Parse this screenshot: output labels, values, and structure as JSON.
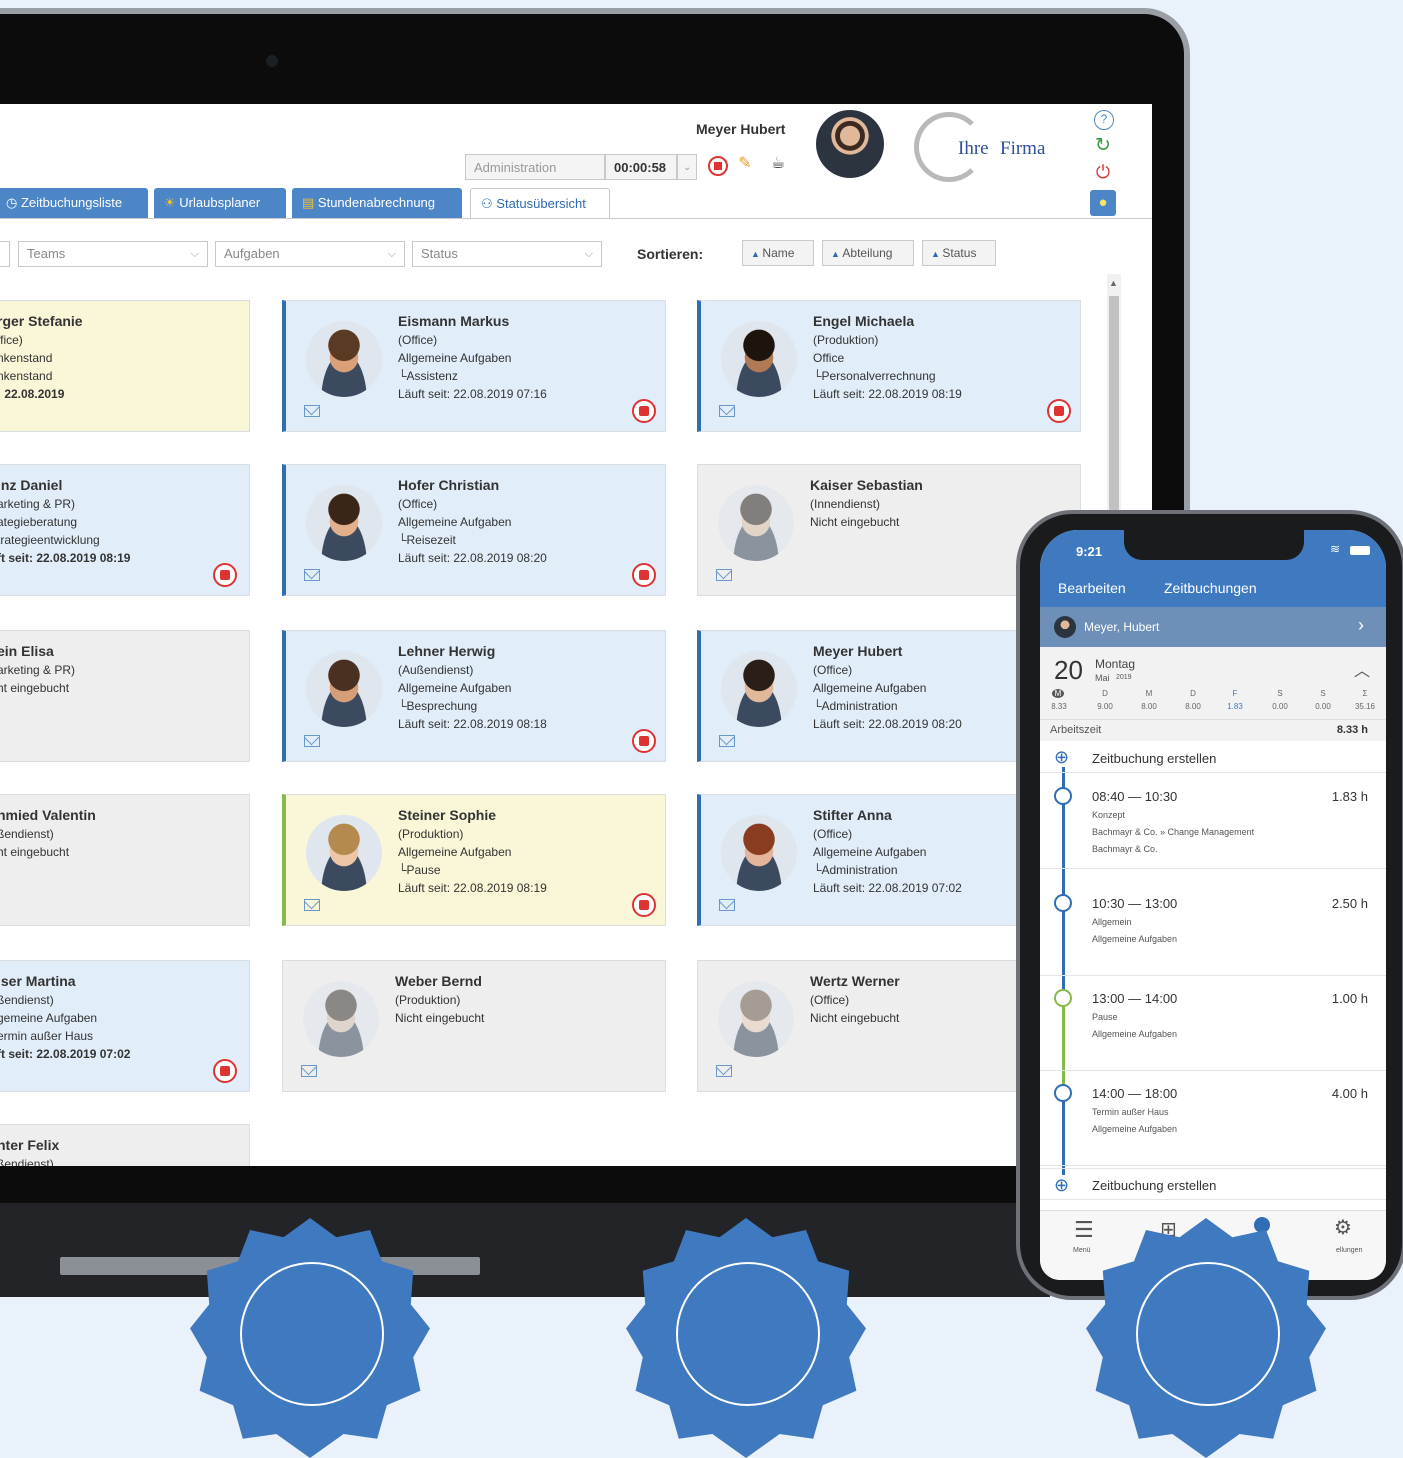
{
  "header": {
    "user_name": "Meyer Hubert",
    "combo_value": "Administration",
    "timer": "00:00:58",
    "logo_text_1": "Ihre",
    "logo_text_2": "Firma"
  },
  "tabs": [
    {
      "label": "Zeitbuchungsliste"
    },
    {
      "label": "Urlaubsplaner"
    },
    {
      "label": "Stundenabrechnung"
    },
    {
      "label": "Statusübersicht"
    }
  ],
  "filters": {
    "teams": "Teams",
    "aufgaben": "Aufgaben",
    "status": "Status",
    "sort_label": "Sortieren:",
    "sort_name": "Name",
    "sort_abteilung": "Abteilung",
    "sort_status": "Status"
  },
  "cards": [
    {
      "name": "rger Stefanie",
      "l1": "ffice)",
      "l2": "nkenstand",
      "l3": "nkenstand",
      "l4": ": 22.08.2019"
    },
    {
      "name": "Eismann Markus",
      "l1": "(Office)",
      "l2": "Allgemeine Aufgaben",
      "l3": "└Assistenz",
      "l4": "Läuft seit: 22.08.2019 07:16"
    },
    {
      "name": "Engel Michaela",
      "l1": "(Produktion)",
      "l2": "Office",
      "l3": "└Personalverrechnung",
      "l4": "Läuft seit: 22.08.2019 08:19"
    },
    {
      "name": "inz Daniel",
      "l1": "arketing & PR)",
      "l2": "ategieberatung",
      "l3": "trategieentwicklung",
      "l4": "ft seit: 22.08.2019 08:19"
    },
    {
      "name": "Hofer Christian",
      "l1": "(Office)",
      "l2": "Allgemeine Aufgaben",
      "l3": "└Reisezeit",
      "l4": "Läuft seit: 22.08.2019 08:20"
    },
    {
      "name": "Kaiser Sebastian",
      "l1": "(Innendienst)",
      "l2": "Nicht eingebucht"
    },
    {
      "name": "ein Elisa",
      "l1": "arketing & PR)",
      "l2": "ht eingebucht"
    },
    {
      "name": "Lehner Herwig",
      "l1": "(Außendienst)",
      "l2": "Allgemeine Aufgaben",
      "l3": "└Besprechung",
      "l4": "Läuft seit: 22.08.2019 08:18"
    },
    {
      "name": "Meyer Hubert",
      "l1": "(Office)",
      "l2": "Allgemeine Aufgaben",
      "l3": "└Administration",
      "l4": "Läuft seit: 22.08.2019 08:20"
    },
    {
      "name": "hmied Valentin",
      "l1": "ßendienst)",
      "l2": "ht eingebucht"
    },
    {
      "name": "Steiner Sophie",
      "l1": "(Produktion)",
      "l2": "Allgemeine Aufgaben",
      "l3": "└Pause",
      "l4": "Läuft seit: 22.08.2019 08:19"
    },
    {
      "name": "Stifter Anna",
      "l1": "(Office)",
      "l2": "Allgemeine Aufgaben",
      "l3": "└Administration",
      "l4": "Läuft seit: 22.08.2019 07:02"
    },
    {
      "name": "lser Martina",
      "l1": "ßendienst)",
      "l2": "gemeine Aufgaben",
      "l3": "ermin außer Haus",
      "l4": "ft seit: 22.08.2019 07:02"
    },
    {
      "name": "Weber Bernd",
      "l1": "(Produktion)",
      "l2": "Nicht eingebucht"
    },
    {
      "name": "Wertz Werner",
      "l1": "(Office)",
      "l2": "Nicht eingebucht"
    },
    {
      "name": "nter Felix",
      "l1": "ßendienst)"
    }
  ],
  "phone": {
    "time": "9:21",
    "nav_edit": "Bearbeiten",
    "nav_title": "Zeitbuchungen",
    "user": "Meyer, Hubert",
    "day_num": "20",
    "day_name": "Montag",
    "month": "Mai",
    "year": "2019",
    "week_days": [
      "M",
      "D",
      "M",
      "D",
      "F",
      "S",
      "S",
      "Σ"
    ],
    "week_values": [
      "8.33",
      "9.00",
      "8.00",
      "8.00",
      "1.83",
      "0.00",
      "0.00",
      "35.16"
    ],
    "arbeitszeit_label": "Arbeitszeit",
    "arbeitszeit_value": "8.33 h",
    "create_label": "Zeitbuchung erstellen",
    "entries": [
      {
        "time": "08:40 — 10:30",
        "dur": "1.83 h",
        "sub1": "Konzept",
        "sub2": "Bachmayr & Co. » Change Management",
        "sub3": "Bachmayr & Co."
      },
      {
        "time": "10:30 — 13:00",
        "dur": "2.50 h",
        "sub1": "Allgemein",
        "sub2": "Allgemeine Aufgaben"
      },
      {
        "time": "13:00 — 14:00",
        "dur": "1.00 h",
        "sub1": "Pause",
        "sub2": "Allgemeine Aufgaben"
      },
      {
        "time": "14:00 — 18:00",
        "dur": "4.00 h",
        "sub1": "Termin außer Haus",
        "sub2": "Allgemeine Aufgaben"
      }
    ],
    "tab_menu": "Menü",
    "tab_settings": "ellungen"
  },
  "colors": {
    "accent": "#3f7ac0",
    "stop": "#dd3333",
    "card_blue": "#e1edf9",
    "card_yellow": "#faf6d8",
    "card_grey": "#eeeeee"
  }
}
